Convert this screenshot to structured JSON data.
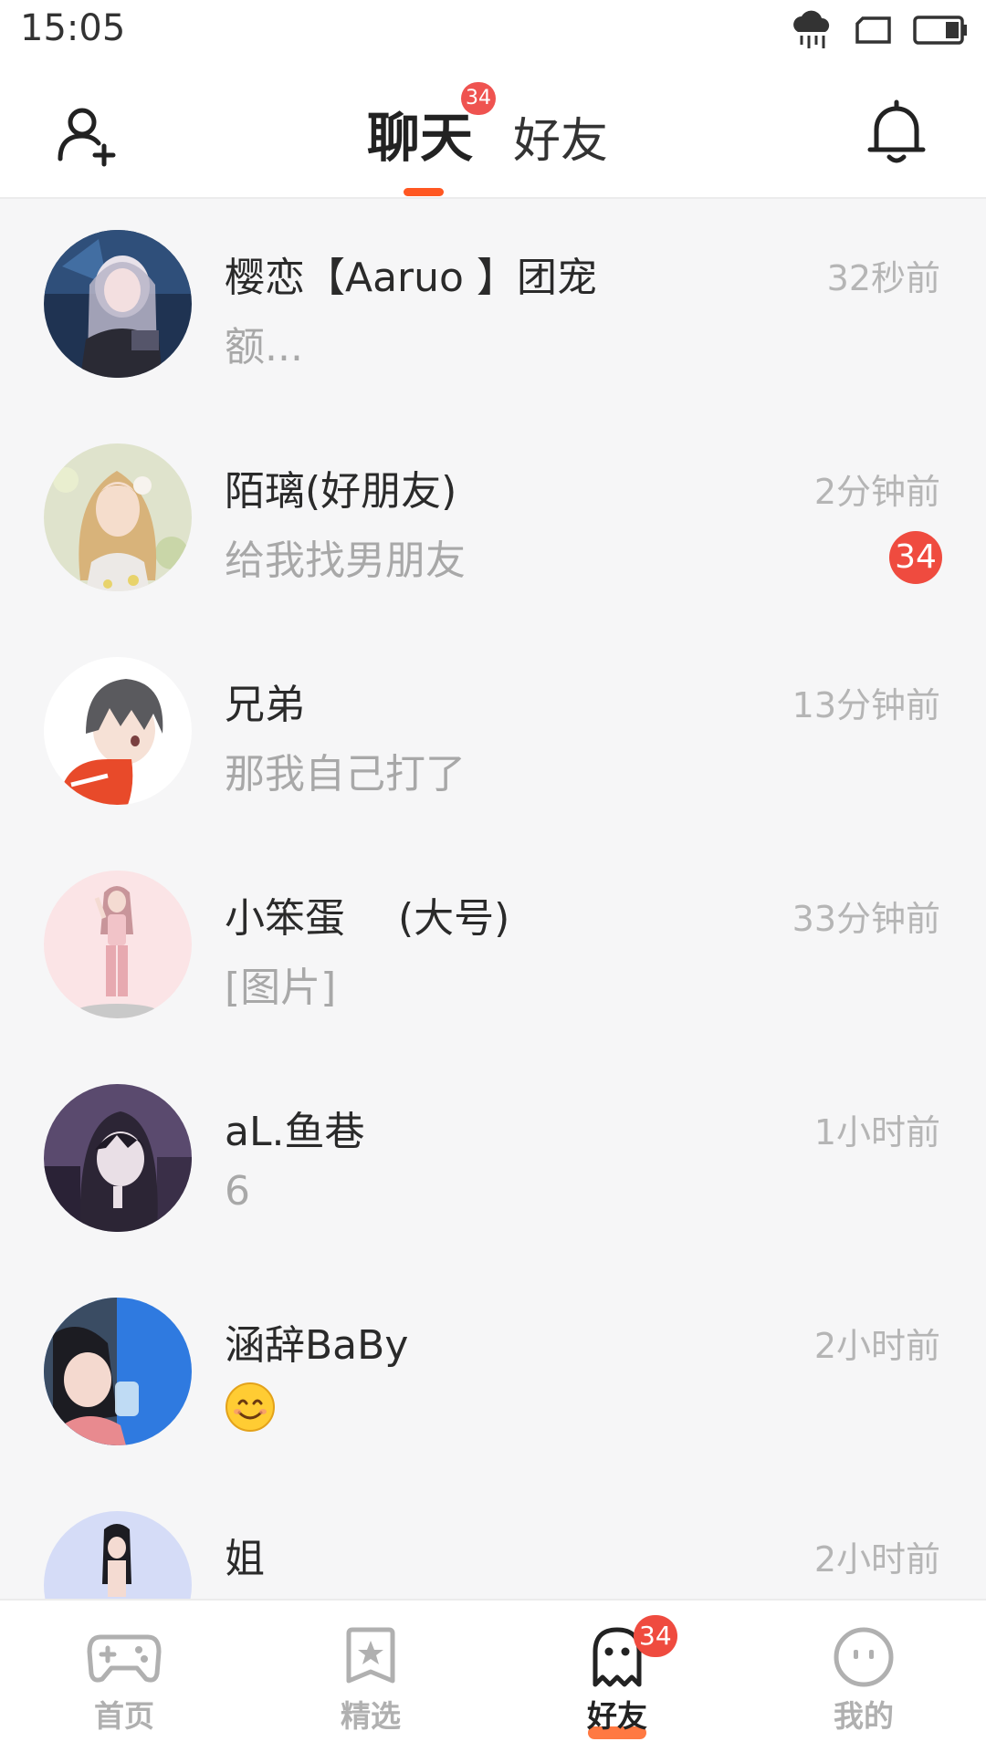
{
  "status_bar": {
    "time": "15:05",
    "icons": [
      "weather-rain-icon",
      "sim-card-icon",
      "battery-icon"
    ]
  },
  "header": {
    "tabs": [
      {
        "label": "聊天",
        "active": true,
        "badge": "34"
      },
      {
        "label": "好友",
        "active": false
      }
    ],
    "left_icon": "add-friend-icon",
    "right_icon": "bell-icon",
    "accent_color": "#ff5722"
  },
  "chats": [
    {
      "name": "樱恋【Aaruo 】团宠",
      "preview": "额...",
      "time": "32秒前",
      "unread": ""
    },
    {
      "name": "陌璃(好朋友)",
      "preview": "给我找男朋友",
      "time": "2分钟前",
      "unread": "34"
    },
    {
      "name": "兄弟",
      "preview": "那我自己打了",
      "time": "13分钟前",
      "unread": ""
    },
    {
      "name": "小笨蛋 　(大号)",
      "preview": "[图片]",
      "time": "33分钟前",
      "unread": ""
    },
    {
      "name": "aL.鱼巷",
      "preview": "6",
      "time": "1小时前",
      "unread": ""
    },
    {
      "name": "涵辞BaBy",
      "preview": "",
      "preview_icon": "smile-emoji-icon",
      "time": "2小时前",
      "unread": ""
    },
    {
      "name": "姐",
      "preview": "",
      "time": "2小时前",
      "unread": ""
    }
  ],
  "bottom_nav": {
    "items": [
      {
        "label": "首页",
        "icon": "gamepad-icon",
        "active": false
      },
      {
        "label": "精选",
        "icon": "star-bookmark-icon",
        "active": false
      },
      {
        "label": "好友",
        "icon": "ghost-icon",
        "active": true,
        "badge": "34"
      },
      {
        "label": "我的",
        "icon": "face-icon",
        "active": false
      }
    ]
  },
  "colors": {
    "badge": "#ef4b3f",
    "accent": "#ff5722",
    "background": "#f6f6f7"
  }
}
